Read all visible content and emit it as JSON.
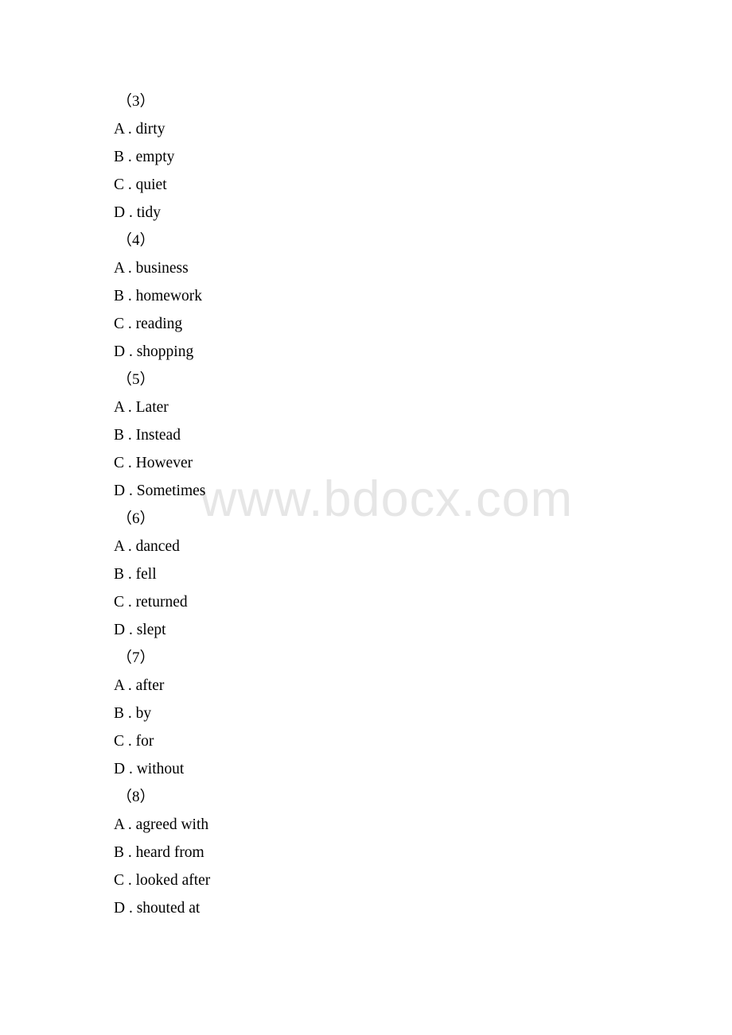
{
  "document": {
    "type": "multiple-choice-answer-options",
    "watermark": "www.bdocx.com",
    "questions": [
      {
        "number": "（3）",
        "options": [
          {
            "letter": "A .",
            "text": "dirty"
          },
          {
            "letter": "B .",
            "text": "empty"
          },
          {
            "letter": "C .",
            "text": "quiet"
          },
          {
            "letter": "D .",
            "text": "tidy"
          }
        ]
      },
      {
        "number": "（4）",
        "options": [
          {
            "letter": "A .",
            "text": "business"
          },
          {
            "letter": "B .",
            "text": "homework"
          },
          {
            "letter": "C .",
            "text": "reading"
          },
          {
            "letter": "D .",
            "text": "shopping"
          }
        ]
      },
      {
        "number": "（5）",
        "options": [
          {
            "letter": "A .",
            "text": "Later"
          },
          {
            "letter": "B .",
            "text": "Instead"
          },
          {
            "letter": "C .",
            "text": "However"
          },
          {
            "letter": "D .",
            "text": "Sometimes"
          }
        ]
      },
      {
        "number": "（6）",
        "options": [
          {
            "letter": "A .",
            "text": "danced"
          },
          {
            "letter": "B .",
            "text": "fell"
          },
          {
            "letter": "C .",
            "text": "returned"
          },
          {
            "letter": "D .",
            "text": "slept"
          }
        ]
      },
      {
        "number": "（7）",
        "options": [
          {
            "letter": "A .",
            "text": "after"
          },
          {
            "letter": "B .",
            "text": "by"
          },
          {
            "letter": "C .",
            "text": "for"
          },
          {
            "letter": "D .",
            "text": "without"
          }
        ]
      },
      {
        "number": "（8）",
        "options": [
          {
            "letter": "A .",
            "text": "agreed with"
          },
          {
            "letter": "B .",
            "text": "heard from"
          },
          {
            "letter": "C .",
            "text": "looked after"
          },
          {
            "letter": "D .",
            "text": "shouted at"
          }
        ]
      }
    ]
  }
}
